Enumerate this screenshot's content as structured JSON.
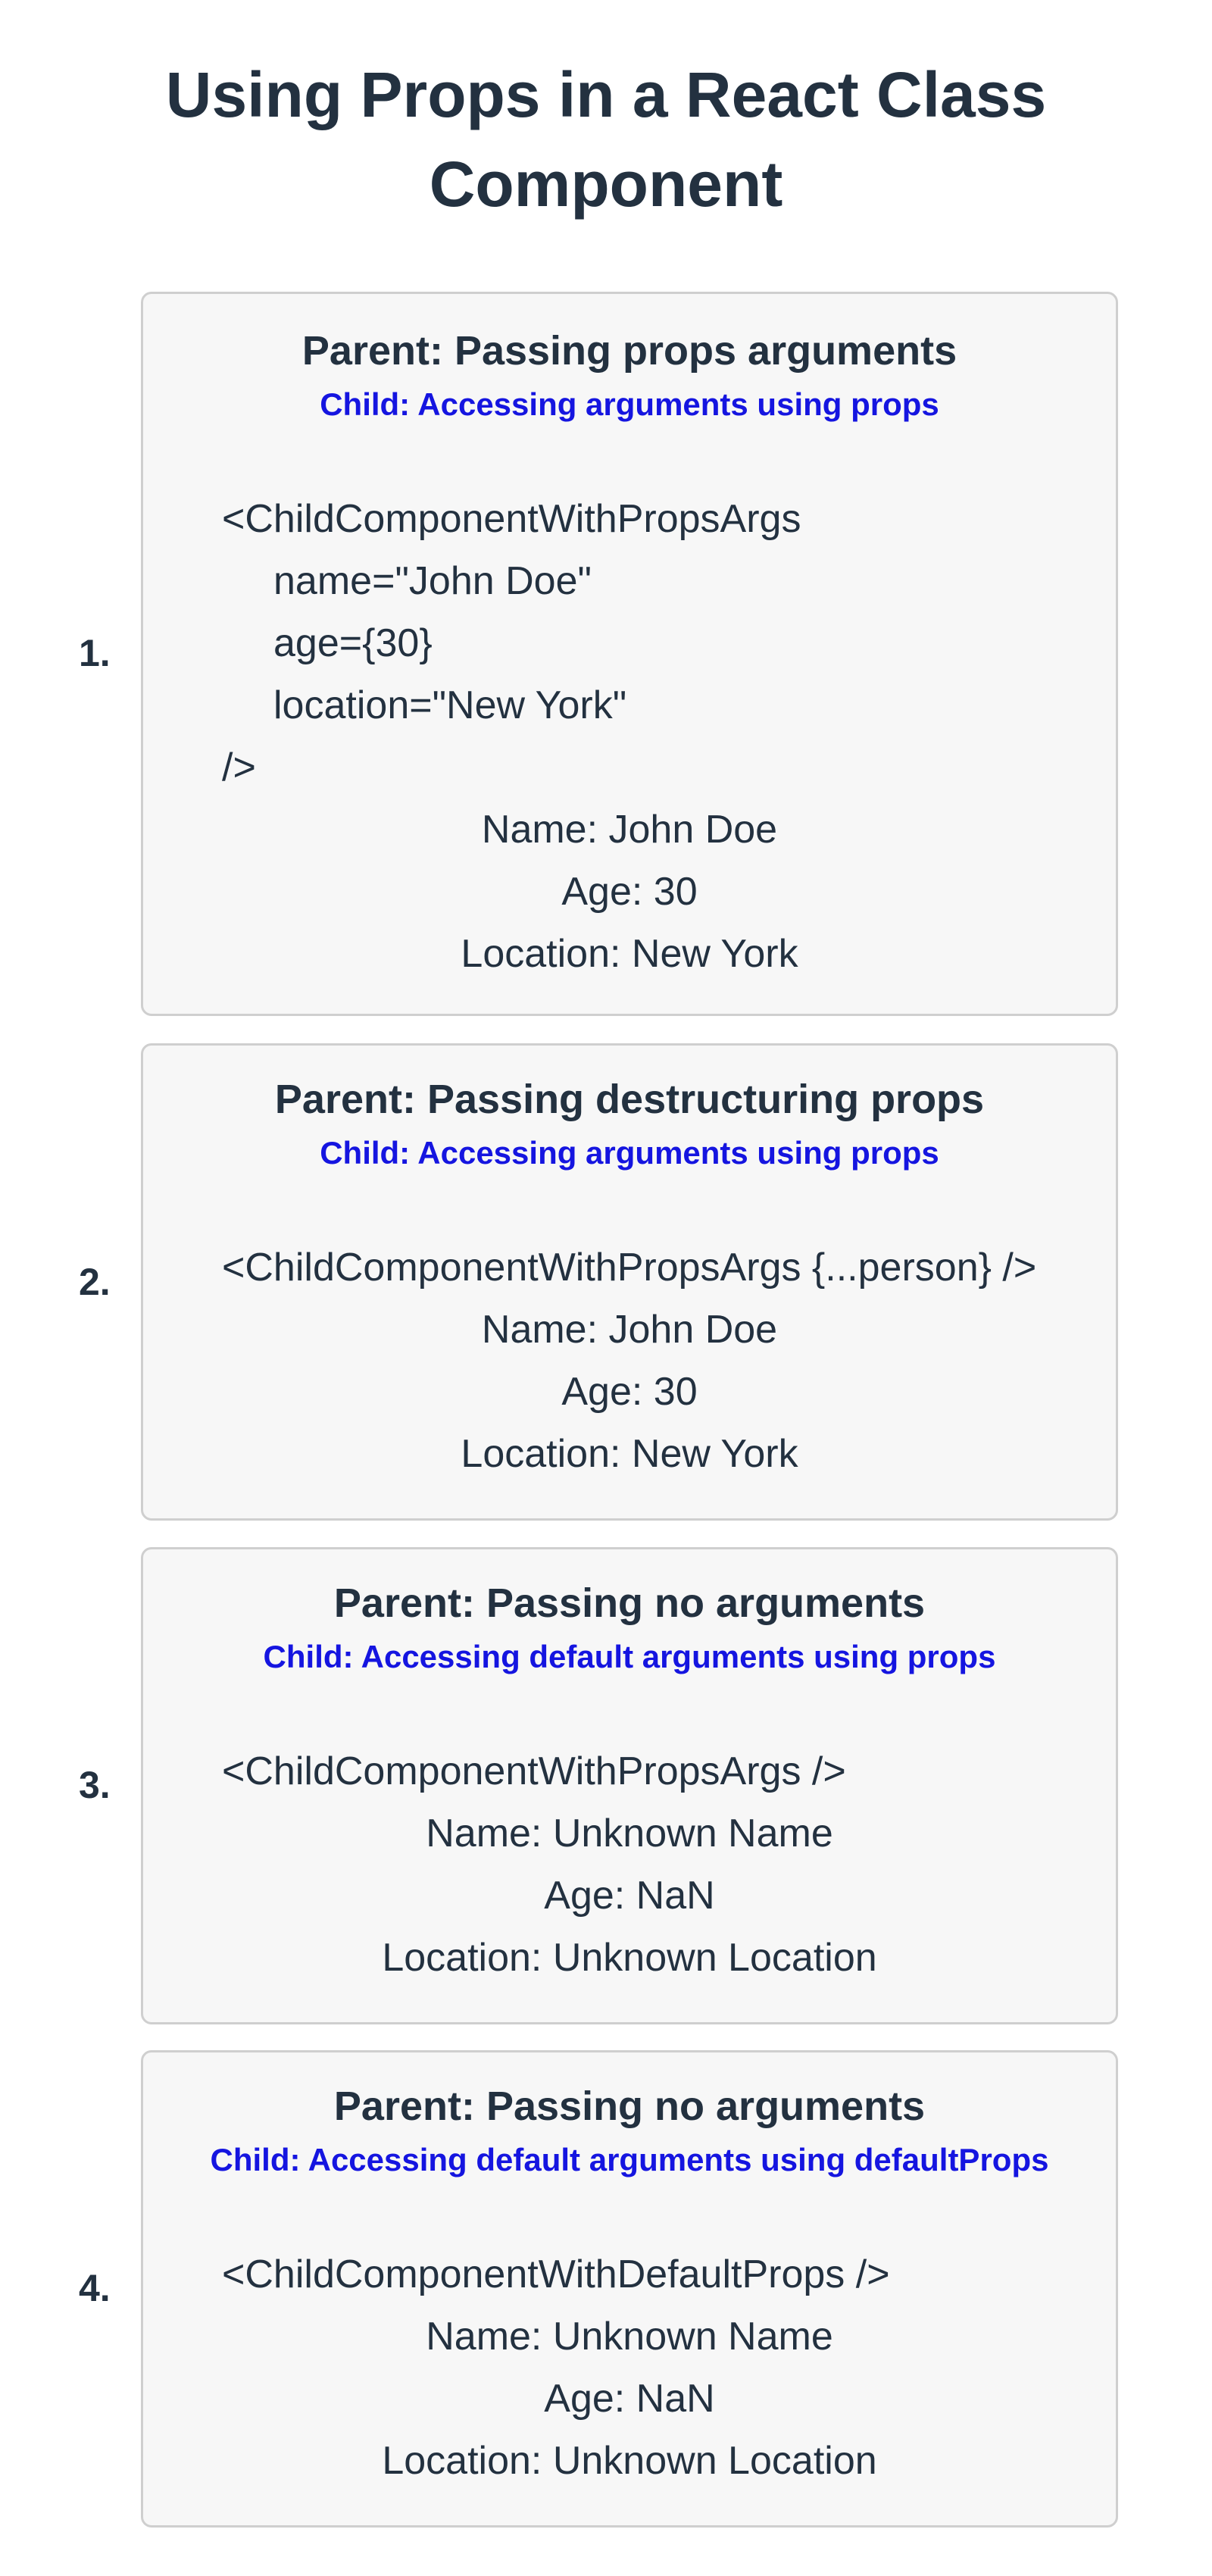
{
  "title_lines": [
    "Using Props in a React Class",
    "Component"
  ],
  "examples": [
    {
      "number": "1.",
      "parent_title": "Parent: Passing props arguments",
      "child_subtitle": "Child: Accessing arguments using props",
      "code_lines": [
        "<ChildComponentWithPropsArgs",
        "name=\"John Doe\"",
        "age={30}",
        "location=\"New York\"",
        "/>"
      ],
      "output_lines": [
        "Name: John Doe",
        "Age: 30",
        "Location: New York"
      ]
    },
    {
      "number": "2.",
      "parent_title": "Parent: Passing destructuring props",
      "child_subtitle": "Child: Accessing arguments using props",
      "code_lines": [
        "<ChildComponentWithPropsArgs {...person} />"
      ],
      "output_lines": [
        "Name: John Doe",
        "Age: 30",
        "Location: New York"
      ]
    },
    {
      "number": "3.",
      "parent_title": "Parent: Passing no arguments",
      "child_subtitle": "Child: Accessing default arguments using props",
      "code_lines": [
        "<ChildComponentWithPropsArgs />"
      ],
      "output_lines": [
        "Name: Unknown Name",
        "Age: NaN",
        "Location: Unknown Location"
      ]
    },
    {
      "number": "4.",
      "parent_title": "Parent: Passing no arguments",
      "child_subtitle": "Child: Accessing default arguments using defaultProps",
      "code_lines": [
        "<ChildComponentWithDefaultProps />"
      ],
      "output_lines": [
        "Name: Unknown Name",
        "Age: NaN",
        "Location: Unknown Location"
      ]
    }
  ]
}
